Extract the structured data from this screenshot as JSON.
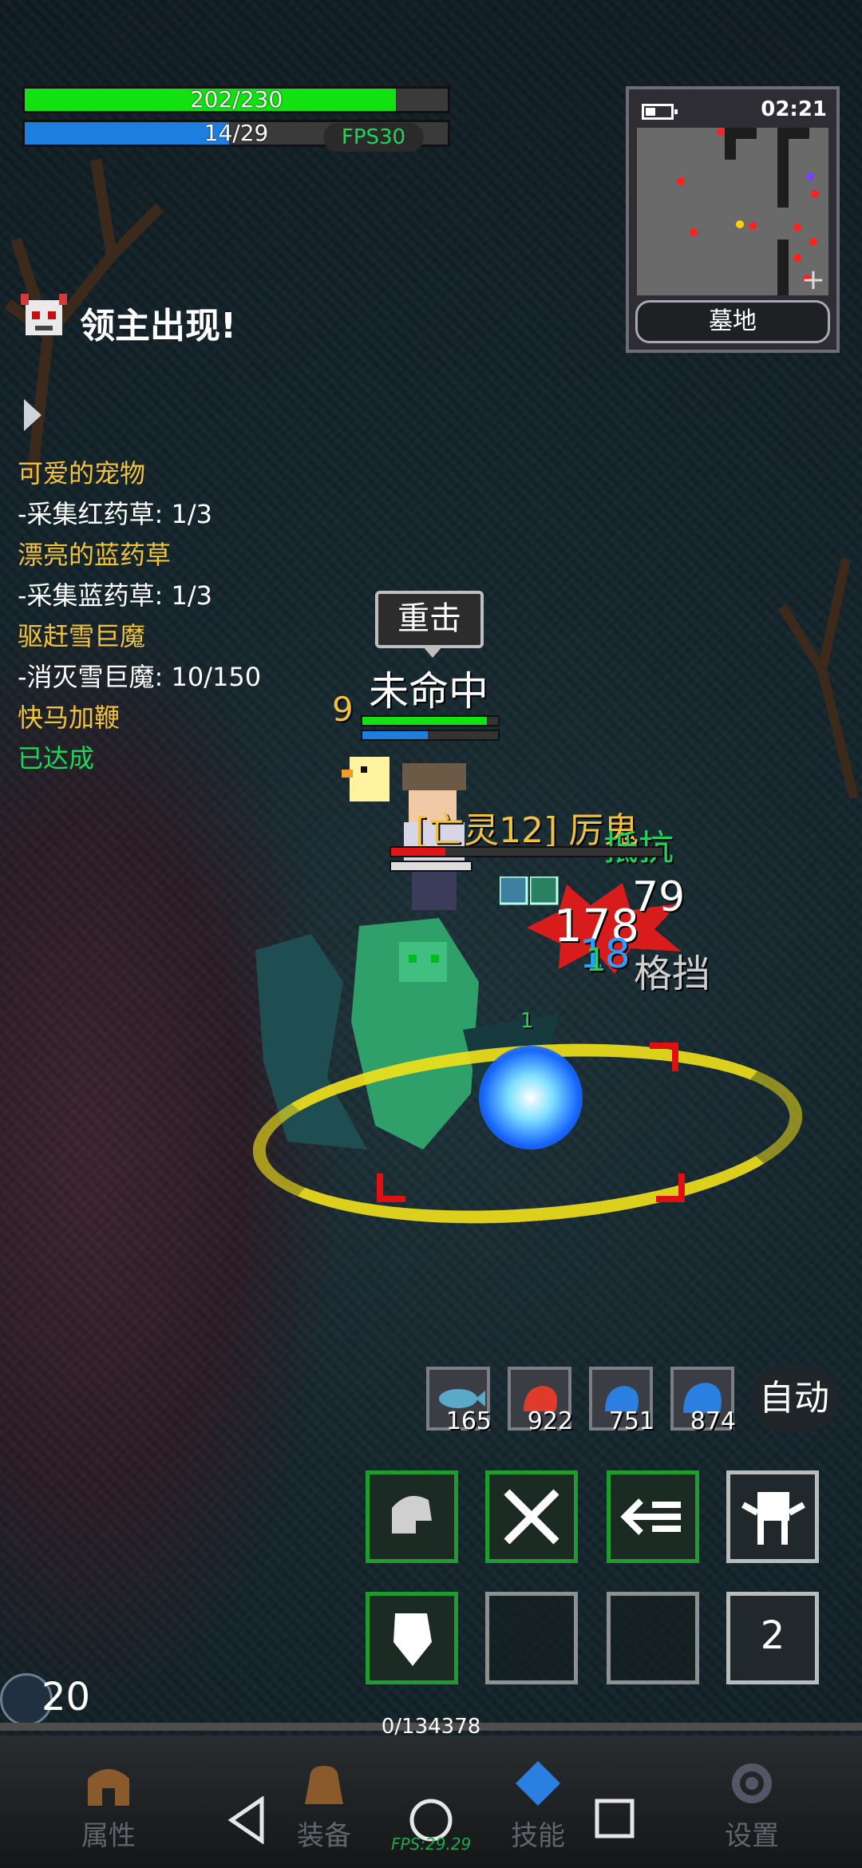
{
  "hud": {
    "hp_text": "202/230",
    "hp_fraction": 0.878,
    "mp_text": "14/29",
    "mp_fraction": 0.483,
    "fps_label": "FPS30"
  },
  "minimap": {
    "time": "02:21",
    "location": "墓地",
    "plus": "+"
  },
  "notice": {
    "text": "领主出现!"
  },
  "quests": [
    {
      "title": "可爱的宠物",
      "step": "-采集红药草: 1/3"
    },
    {
      "title": "漂亮的蓝药草",
      "step": "-采集蓝药草: 1/3"
    },
    {
      "title": "驱赶雪巨魔",
      "step": "-消灭雪巨魔: 10/150"
    },
    {
      "title": "快马加鞭",
      "status": "已达成"
    }
  ],
  "combat": {
    "speech": "重击",
    "miss_text": "未命中",
    "player_level_partial": "9",
    "enemy_name": "[亡灵12] 厉鬼",
    "resist_text": "抵抗",
    "damage_main": "178",
    "damage_blue": "18",
    "damage_green": "1",
    "damage_white": "79",
    "block_text": "格挡",
    "small_green": "1"
  },
  "potions": [
    {
      "name": "fish",
      "count": "165",
      "color": "#5aa9c8"
    },
    {
      "name": "red-potion",
      "count": "922",
      "color": "#e03a2a"
    },
    {
      "name": "blue-potion",
      "count": "751",
      "color": "#2a7fe0"
    },
    {
      "name": "blue-potion-large",
      "count": "874",
      "color": "#2a7fe0"
    }
  ],
  "auto_label": "自动",
  "skills": {
    "cooldown_count": "2"
  },
  "player": {
    "level": "20",
    "exp_text": "0/134378"
  },
  "nav": {
    "attributes": "属性",
    "equipment": "装备",
    "skills": "技能",
    "settings": "设置",
    "fps_sys": "FPS:29.29"
  },
  "colors": {
    "hp": "#12e212",
    "mp": "#1e7ee0",
    "quest_title": "#f2c23b",
    "quest_done": "#1fd45b",
    "skill_border": "#1f9c2e"
  }
}
